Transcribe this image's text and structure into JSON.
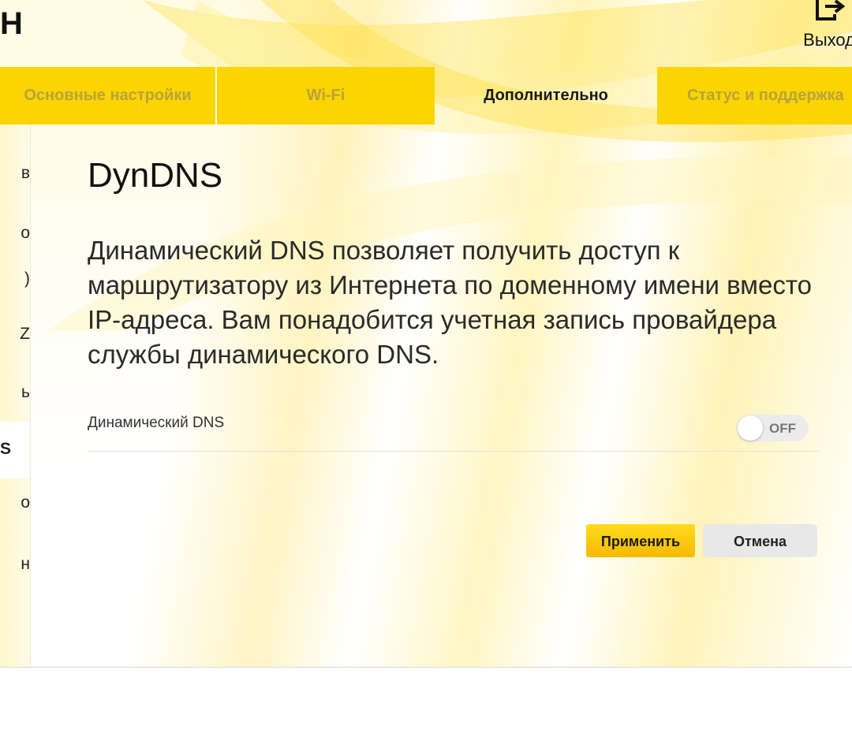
{
  "header": {
    "brand_fragment": "Н",
    "logout_label": "Выход",
    "logout_icon": "logout-icon"
  },
  "tabs": [
    {
      "label": "Основные настройки",
      "active": false
    },
    {
      "label": "Wi-Fi",
      "active": false
    },
    {
      "label": "Дополнительно",
      "active": true
    },
    {
      "label": "Статус и поддержка",
      "active": false
    }
  ],
  "sidebar": {
    "items": [
      {
        "label": "в"
      },
      {
        "label": "о"
      },
      {
        "label": ")"
      },
      {
        "label": "Z"
      },
      {
        "label": "ь"
      },
      {
        "label": "S",
        "active": true
      },
      {
        "label": "о"
      },
      {
        "label": "н"
      }
    ]
  },
  "main": {
    "title": "DynDNS",
    "description": "Динамический DNS позволяет получить доступ к маршрутизатору из Интернета по доменному имени вместо IP-адреса. Вам понадобится учетная запись провайдера службы динамического DNS.",
    "setting": {
      "label": "Динамический DNS",
      "toggle_state": "OFF"
    },
    "buttons": {
      "apply": "Применить",
      "cancel": "Отмена"
    }
  },
  "colors": {
    "accent": "#fcd400",
    "tab_inactive_text": "#b9a33a",
    "apply_button": "#f6b800"
  }
}
